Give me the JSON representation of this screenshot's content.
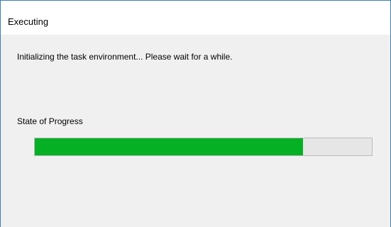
{
  "window": {
    "title": "Executing",
    "message": "Initializing the task environment... Please wait for a while."
  },
  "progress": {
    "label": "State of Progress",
    "fraction": 0.795,
    "fill_color": "#06b025",
    "track_color": "#e6e6e6"
  }
}
